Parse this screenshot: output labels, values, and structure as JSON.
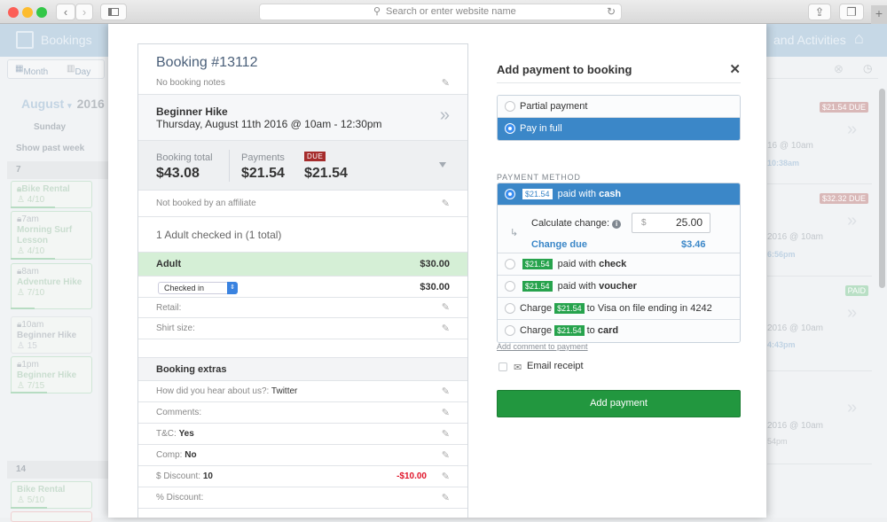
{
  "browser": {
    "back": "‹",
    "forward": "›",
    "url_placeholder": "Search or enter website name",
    "plus": "+"
  },
  "app": {
    "header_left": "Bookings",
    "header_right": "and Activities",
    "view_month": "Month",
    "view_day": "Day",
    "month": "August",
    "year": "2016",
    "weekday": "Sunday",
    "show_past_week": "Show past week",
    "day_7": "7",
    "day_14": "14",
    "events": [
      {
        "time": "",
        "name": "Bike Rental",
        "capacity": "4/10"
      },
      {
        "time": "7am",
        "name": "Morning Surf Lesson",
        "capacity": "4/10"
      },
      {
        "time": "8am",
        "name": "Adventure Hike",
        "capacity": "7/10"
      },
      {
        "time": "10am",
        "name": "Beginner Hike",
        "capacity": "15"
      },
      {
        "time": "1pm",
        "name": "Beginner Hike",
        "capacity": "7/15"
      },
      {
        "time": "",
        "name": "Bike Rental",
        "capacity": "5/10"
      }
    ],
    "right_cards": [
      {
        "badge": "$21.54 DUE",
        "date": "16 @ 10am",
        "time": "10:38am"
      },
      {
        "badge": "$32.32 DUE",
        "date": "2016 @ 10am",
        "time": "6:56pm"
      },
      {
        "badge": "PAID",
        "date": "2016 @ 10am",
        "time": "4:43pm"
      },
      {
        "badge": "",
        "date": "2016 @ 10am",
        "time": "54pm"
      }
    ]
  },
  "booking": {
    "title": "Booking #13112",
    "notes": "No booking notes",
    "activity": "Beginner Hike",
    "datetime": "Thursday, August 11th 2016 @ 10am - 12:30pm",
    "total_label": "Booking total",
    "total": "$43.08",
    "payments_label": "Payments",
    "payments": "$21.54",
    "due_label": "DUE",
    "due": "$21.54",
    "affiliate": "Not booked by an affiliate",
    "checked_in": "1 Adult checked in (1 total)",
    "guest_type": "Adult",
    "guest_price": "$30.00",
    "status_select": "Checked in",
    "status_price": "$30.00",
    "retail_label": "Retail:",
    "shirt_label": "Shirt size:",
    "extras_title": "Booking extras",
    "extras": [
      {
        "label": "How did you hear about us?:",
        "value": "Twitter",
        "amount": ""
      },
      {
        "label": "Comments:",
        "value": "",
        "amount": ""
      },
      {
        "label": "T&C:",
        "value": "Yes",
        "amount": ""
      },
      {
        "label": "Comp:",
        "value": "No",
        "amount": ""
      },
      {
        "label": "$ Discount:",
        "value": "10",
        "amount": "-$10.00"
      },
      {
        "label": "% Discount:",
        "value": "",
        "amount": ""
      }
    ]
  },
  "payment": {
    "title": "Add payment to booking",
    "close": "✕",
    "partial": "Partial payment",
    "full": "Pay in full",
    "method_label": "PAYMENT METHOD",
    "amount": "$21.54",
    "cash_prefix": "paid with",
    "cash": "cash",
    "calc_label": "Calculate change:",
    "currency": "$",
    "tendered": "25.00",
    "change_label": "Change due",
    "change": "$3.46",
    "check": "check",
    "voucher": "voucher",
    "charge": "Charge",
    "visa_suffix": "to Visa on file ending in 4242",
    "card_to": "to",
    "card": "card",
    "comment_link": "Add comment to payment",
    "email_receipt": "Email receipt",
    "submit": "Add payment"
  },
  "colors": {
    "primary_blue": "#3b87c8",
    "success_green": "#22973f",
    "due_red": "#a52c2c",
    "discount_red": "#e0152a"
  }
}
